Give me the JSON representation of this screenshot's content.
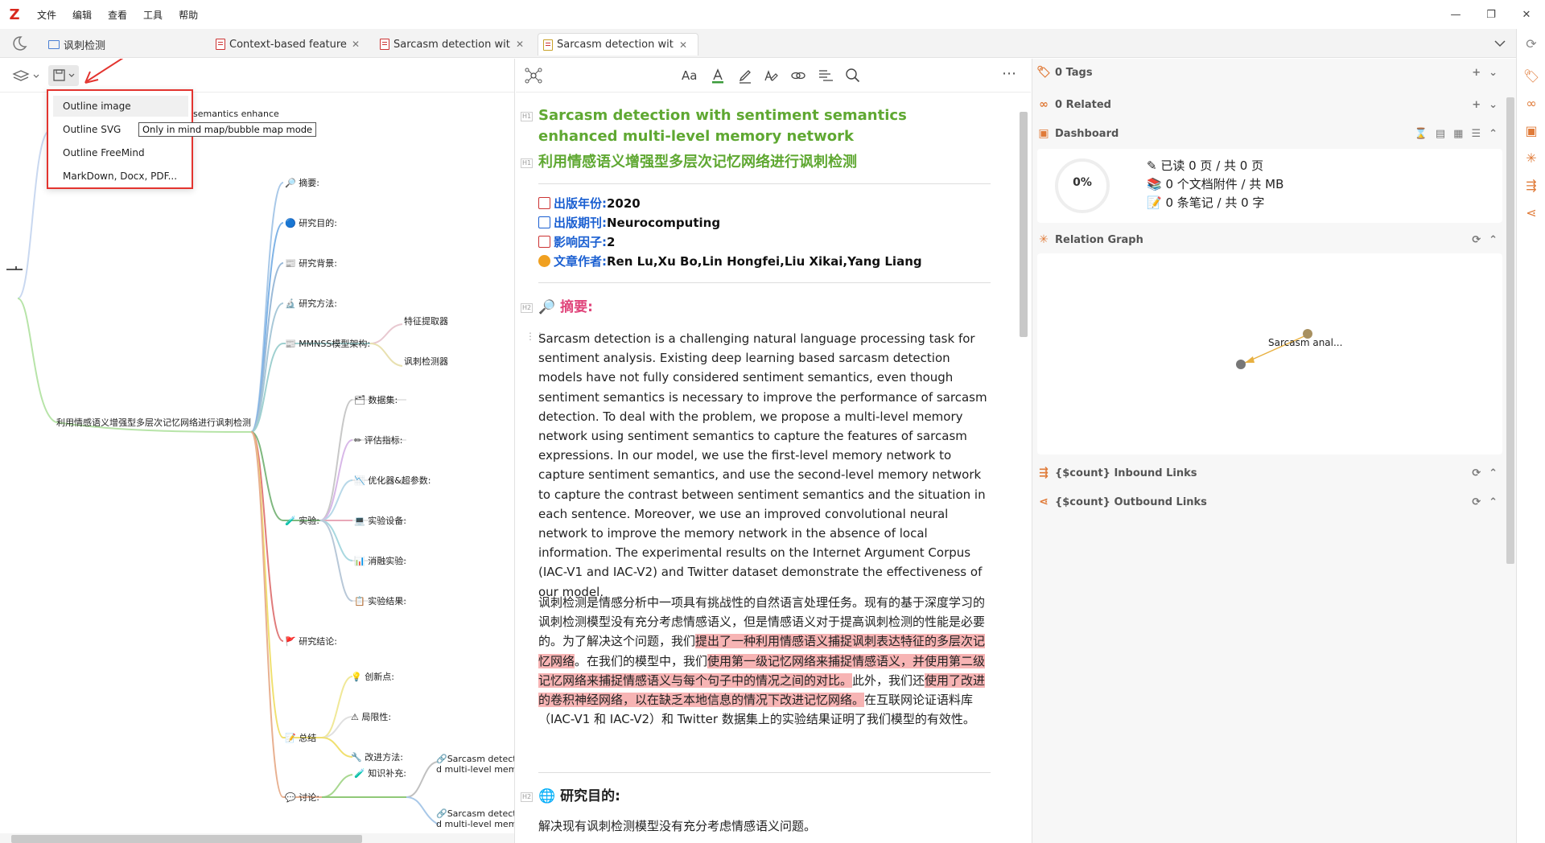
{
  "menubar": {
    "logo": "Z",
    "items": [
      "文件",
      "编辑",
      "查看",
      "工具",
      "帮助"
    ],
    "window_controls": [
      "—",
      "❐",
      "✕"
    ]
  },
  "tabs": [
    {
      "label": "讽刺检测",
      "kind": "collection",
      "active": false
    },
    {
      "label": "Context-based feature t",
      "kind": "pdf",
      "active": false
    },
    {
      "label": "Sarcasm detection with",
      "kind": "pdf",
      "active": false
    },
    {
      "label": "Sarcasm detection with",
      "kind": "note",
      "active": true
    }
  ],
  "dropdown": {
    "items": [
      "Outline image",
      "Outline SVG",
      "Outline FreeMind",
      "MarkDown, Docx, PDF..."
    ],
    "tooltip": "Only in mind map/bubble map mode"
  },
  "mindmap": {
    "root": "利用情感语义增强型多层次记忆网络进行讽刺检测",
    "peek_label": "semantics enhance",
    "nodes": {
      "abstract": "🔎 摘要:",
      "purpose": "🔵 研究目的:",
      "background": "📰 研究背景:",
      "method": "🔬 研究方法:",
      "mmnss": "📰 MMNSS模型架构:",
      "feature": "特征提取器",
      "detector": "讽刺检测器",
      "experiment": "🧪 实验:",
      "dataset": "🗂 数据集:",
      "metrics": "✏ 评估指标:",
      "optimizer": "📉 优化器&超参数:",
      "device": "💻 实验设备:",
      "ablation": "📊 消融实验:",
      "result": "📋 实验结果:",
      "conclusion": "🚩 研究结论:",
      "summary": "📝 总结",
      "innovation": "💡 创新点:",
      "limitation": "⚠ 局限性:",
      "improve": "🔧 改进方法:",
      "discussion": "💬 讨论:",
      "supplement": "🧪 知识补充:",
      "ref1_a": "🔗Sarcasm detecti",
      "ref1_b": "d multi-level memor",
      "ref2_a": "🔗Sarcasm detecti",
      "ref2_b": "d multi-level memor"
    }
  },
  "doc": {
    "h1_en": "Sarcasm detection with sentiment semantics enhanced multi-level memory network",
    "h1_zh": "利用情感语义增强型多层次记忆网络进行讽刺检测",
    "heading_tag_h1": "H1",
    "heading_tag_h2": "H2",
    "meta": [
      {
        "key": "出版年份:",
        "value": "2020"
      },
      {
        "key": "出版期刊:",
        "value": "Neurocomputing"
      },
      {
        "key": "影响因子:",
        "value": "2"
      },
      {
        "key": "文章作者:",
        "value": "Ren Lu,Xu Bo,Lin Hongfei,Liu Xikai,Yang Liang"
      }
    ],
    "h2_abstract": "🔎 摘要:",
    "abstract_en": "Sarcasm detection is a challenging natural language processing task for sentiment analysis. Existing deep learning based sarcasm detection models have not fully considered sentiment semantics, even though sentiment semantics is necessary to improve the performance of sarcasm detection. To deal with the problem, we propose a multi-level memory network using sentiment semantics to capture the features of sarcasm expressions. In our model, we use the first-level memory network to capture sentiment semantics, and use the second-level memory network to capture the contrast between sentiment semantics and the situation in each sentence. Moreover, we use an improved convolutional neural network to improve the memory network in the absence of local information. The experimental results on the Internet Argument Corpus (IAC-V1 and IAC-V2) and Twitter dataset demonstrate the effectiveness of our model.",
    "abstract_zh": {
      "p1": "讽刺检测是情感分析中一项具有挑战性的自然语言处理任务。现有的基于深度学习的讽刺检测模型没有充分考虑情感语义，但是情感语义对于提高讽刺检测的性能是必要的。为了解决这个问题，我们",
      "h1": "提出了一种利用情感语义捕捉讽刺表达特征的多层次记忆网络",
      "p2": "。在我们的模型中，我们",
      "h2": "使用第一级记忆网络来捕捉情感语义，并使用第二级记忆网络来捕捉情感语义与每个句子中的情况之间的对比。",
      "p3": "此外，我们还",
      "h3": "使用了改进的卷积神经网络，以在缺乏本地信息的情况下改进记忆网络。",
      "p4": "在互联网论证语料库（IAC-V1 和 IAC-V2）和 Twitter 数据集上的实验结果证明了我们模型的有效性。"
    },
    "h2_purpose": "🌐 研究目的:",
    "purpose_text": "解决现有讽刺检测模型没有充分考虑情感语义问题。"
  },
  "right": {
    "tags": "0 Tags",
    "related": "0 Related",
    "dashboard": "Dashboard",
    "progress": "0%",
    "progress_fraction": 0,
    "dash_lines": [
      "已读 0 页 / 共 0 页",
      "0 个文档附件 / 共 MB",
      "0 条笔记 / 共 0 字"
    ],
    "relation_graph": "Relation Graph",
    "graph_node": "Sarcasm anal...",
    "inbound": "{$count} Inbound Links",
    "outbound": "{$count} Outbound Links"
  },
  "colors": {
    "accent": "#e07b39",
    "heading_green": "#5fa832",
    "meta_blue": "#1a5fd1",
    "highlight": "#f7b4b4",
    "red_box": "#e3342f",
    "abstract_pink": "#e0457b"
  }
}
